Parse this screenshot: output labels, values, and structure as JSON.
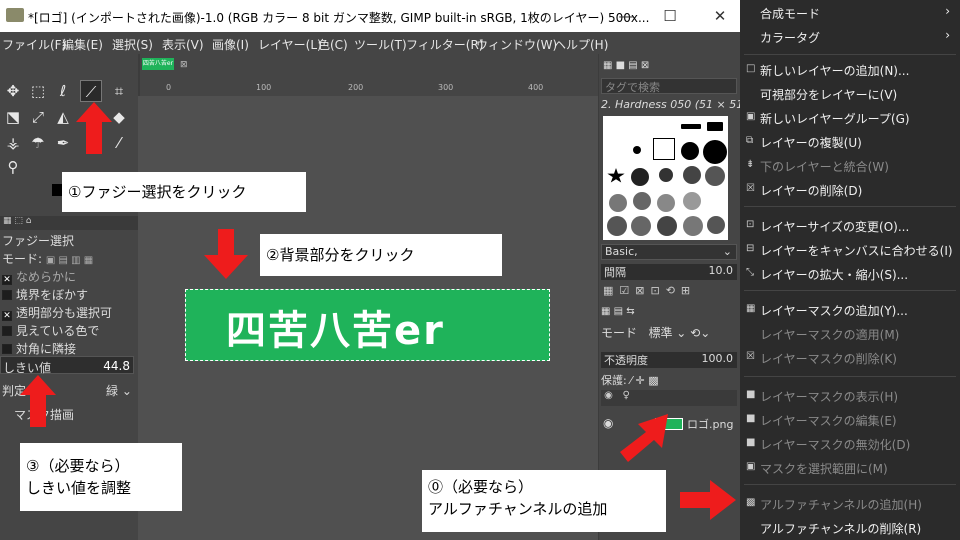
{
  "window": {
    "title": "*[ロゴ] (インポートされた画像)-1.0 (RGB カラー 8 bit ガンマ整数, GIMP built-in sRGB, 1枚のレイヤー) 500x...",
    "min": "—",
    "max": "☐",
    "close": "✕"
  },
  "menubar": [
    "ファイル(F)",
    "編集(E)",
    "選択(S)",
    "表示(V)",
    "画像(I)",
    "レイヤー(L)",
    "色(C)",
    "ツール(T)",
    "フィルター(R)",
    "ウィンドウ(W)",
    "ヘルプ(H)"
  ],
  "tool_options": {
    "title": "ファジー選択",
    "mode_label": "モード:",
    "opts": [
      "なめらかに",
      "境界をぼかす",
      "透明部分も選択可",
      "見えている色で",
      "対角に隣接"
    ],
    "threshold_label": "しきい値",
    "threshold_value": "44.8",
    "criterion_label": "判定",
    "criterion_value": "緑",
    "draw_mask": "マスク描画"
  },
  "canvas": {
    "tab_label": "四苦八苦er",
    "ruler_labels": [
      "0",
      "100",
      "200",
      "300",
      "400"
    ],
    "image_text": "四苦八苦er"
  },
  "brushes": {
    "filter_placeholder": "タグで検索",
    "current": "2. Hardness 050 (51 × 51)",
    "preset": "Basic,",
    "spacing_label": "間隔",
    "spacing_value": "10.0"
  },
  "layers": {
    "mode_label": "モード",
    "mode_value": "標準",
    "opacity_label": "不透明度",
    "opacity_value": "100.0",
    "lock_label": "保護:",
    "layer_name": "ロゴ.png"
  },
  "context_menu": {
    "top_items": [
      {
        "label": "合成モード",
        "arrow": "›"
      },
      {
        "label": "カラータグ",
        "arrow": "›"
      }
    ],
    "items": [
      {
        "label": "新しいレイヤーの追加(N)...",
        "icon": "□",
        "disabled": false
      },
      {
        "label": "可視部分をレイヤーに(V)",
        "icon": "",
        "disabled": false
      },
      {
        "label": "新しいレイヤーグループ(G)",
        "icon": "▣",
        "disabled": false
      },
      {
        "label": "レイヤーの複製(U)",
        "icon": "⧉",
        "disabled": false
      },
      {
        "label": "下のレイヤーと統合(W)",
        "icon": "⇟",
        "disabled": true
      },
      {
        "label": "レイヤーの削除(D)",
        "icon": "☒",
        "disabled": false
      },
      {
        "label": "レイヤーサイズの変更(O)...",
        "icon": "⊡",
        "disabled": false
      },
      {
        "label": "レイヤーをキャンバスに合わせる(I)",
        "icon": "⊟",
        "disabled": false
      },
      {
        "label": "レイヤーの拡大・縮小(S)...",
        "icon": "⤡",
        "disabled": false
      },
      {
        "label": "レイヤーマスクの追加(Y)...",
        "icon": "▦",
        "disabled": false
      },
      {
        "label": "レイヤーマスクの適用(M)",
        "icon": "",
        "disabled": true
      },
      {
        "label": "レイヤーマスクの削除(K)",
        "icon": "☒",
        "disabled": true
      },
      {
        "label": "レイヤーマスクの表示(H)",
        "icon": "■",
        "disabled": true
      },
      {
        "label": "レイヤーマスクの編集(E)",
        "icon": "■",
        "disabled": true
      },
      {
        "label": "レイヤーマスクの無効化(D)",
        "icon": "■",
        "disabled": true
      },
      {
        "label": "マスクを選択範囲に(M)",
        "icon": "▣",
        "disabled": true
      },
      {
        "label": "アルファチャンネルの追加(H)",
        "icon": "▩",
        "disabled": true
      },
      {
        "label": "アルファチャンネルの削除(R)",
        "icon": "",
        "disabled": false
      }
    ]
  },
  "callouts": {
    "step0": "⓪（必要なら）\nアルファチャンネルの追加",
    "step1": "①ファジー選択をクリック",
    "step2": "②背景部分をクリック",
    "step3": "③（必要なら）\nしきい値を調整"
  },
  "colors": {
    "arrow": "#ee1c1c",
    "image_bg": "#1fb35a",
    "menu_bg": "#2b2b2b"
  }
}
